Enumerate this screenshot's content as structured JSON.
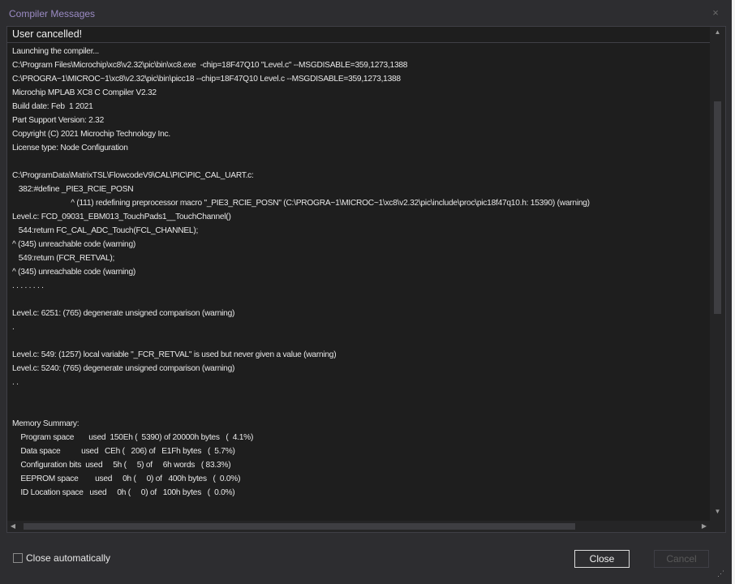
{
  "window": {
    "title": "Compiler Messages",
    "close_glyph": "×"
  },
  "status": "User cancelled!",
  "lines": [
    "Launching the compiler...",
    "C:\\Program Files\\Microchip\\xc8\\v2.32\\pic\\bin\\xc8.exe  -chip=18F47Q10 \"Level.c\" --MSGDISABLE=359,1273,1388",
    "C:\\PROGRA~1\\MICROC~1\\xc8\\v2.32\\pic\\bin\\picc18 --chip=18F47Q10 Level.c --MSGDISABLE=359,1273,1388",
    "Microchip MPLAB XC8 C Compiler V2.32",
    "Build date: Feb  1 2021",
    "Part Support Version: 2.32",
    "Copyright (C) 2021 Microchip Technology Inc.",
    "License type: Node Configuration",
    "",
    "C:\\ProgramData\\MatrixTSL\\FlowcodeV9\\CAL\\PIC\\PIC_CAL_UART.c:",
    "   382:#define _PIE3_RCIE_POSN",
    "                            ^ (111) redefining preprocessor macro \"_PIE3_RCIE_POSN\" (C:\\PROGRA~1\\MICROC~1\\xc8\\v2.32\\pic\\include\\proc\\pic18f47q10.h: 15390) (warning)",
    "Level.c: FCD_09031_EBM013_TouchPads1__TouchChannel()",
    "   544:return FC_CAL_ADC_Touch(FCL_CHANNEL);",
    "^ (345) unreachable code (warning)",
    "   549:return (FCR_RETVAL);",
    "^ (345) unreachable code (warning)",
    ". . . . . . . .",
    "",
    "Level.c: 6251: (765) degenerate unsigned comparison (warning)",
    ".",
    "",
    "Level.c: 549: (1257) local variable \"_FCR_RETVAL\" is used but never given a value (warning)",
    "Level.c: 5240: (765) degenerate unsigned comparison (warning)",
    ". .",
    "",
    "",
    "Memory Summary:",
    "    Program space       used  150Eh (  5390) of 20000h bytes   (  4.1%)",
    "    Data space          used   CEh (   206) of   E1Fh bytes   (  5.7%)",
    "    Configuration bits  used     5h (     5) of     6h words   ( 83.3%)",
    "    EEPROM space        used     0h (     0) of   400h bytes   (  0.0%)",
    "    ID Location space   used     0h (     0) of   100h bytes   (  0.0%)"
  ],
  "footer": {
    "checkbox_label": "Close automatically",
    "close_button": "Close",
    "cancel_button": "Cancel"
  },
  "scroll": {
    "up": "▲",
    "down": "▼",
    "left": "◀",
    "right": "▶"
  },
  "colors": {
    "title_text": "#9b8bc4",
    "background": "#2d2d30",
    "log_background": "#1e1e1e"
  }
}
